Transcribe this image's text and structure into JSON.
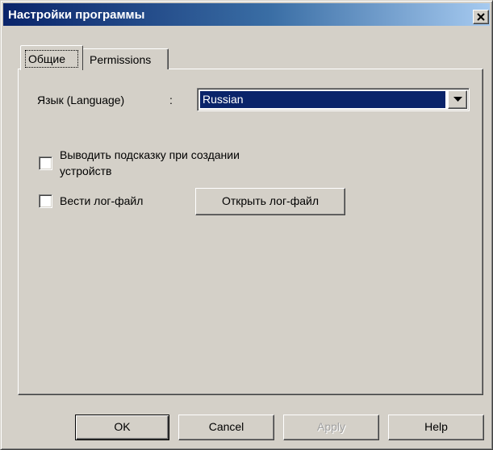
{
  "window": {
    "title": "Настройки программы"
  },
  "tabs": [
    {
      "label": "Общие",
      "selected": true
    },
    {
      "label": "Permissions",
      "selected": false
    }
  ],
  "general": {
    "language_label": "Язык (Language)",
    "language_colon": ":",
    "language_value": "Russian",
    "hint_checkbox": {
      "label_line1": "Выводить подсказку при создании",
      "label_line2": "устройств",
      "checked": false
    },
    "log_checkbox": {
      "label": "Вести лог-файл",
      "checked": false
    },
    "open_log_button": "Открыть лог-файл"
  },
  "footer": {
    "ok": "OK",
    "cancel": "Cancel",
    "apply": "Apply",
    "help": "Help"
  },
  "colors": {
    "title_gradient_start": "#0a246a",
    "title_gradient_end": "#a6caf0",
    "face": "#d4d0c8",
    "selection": "#0a246a"
  },
  "icons": {
    "close": "close-icon",
    "dropdown": "chevron-down-icon"
  }
}
